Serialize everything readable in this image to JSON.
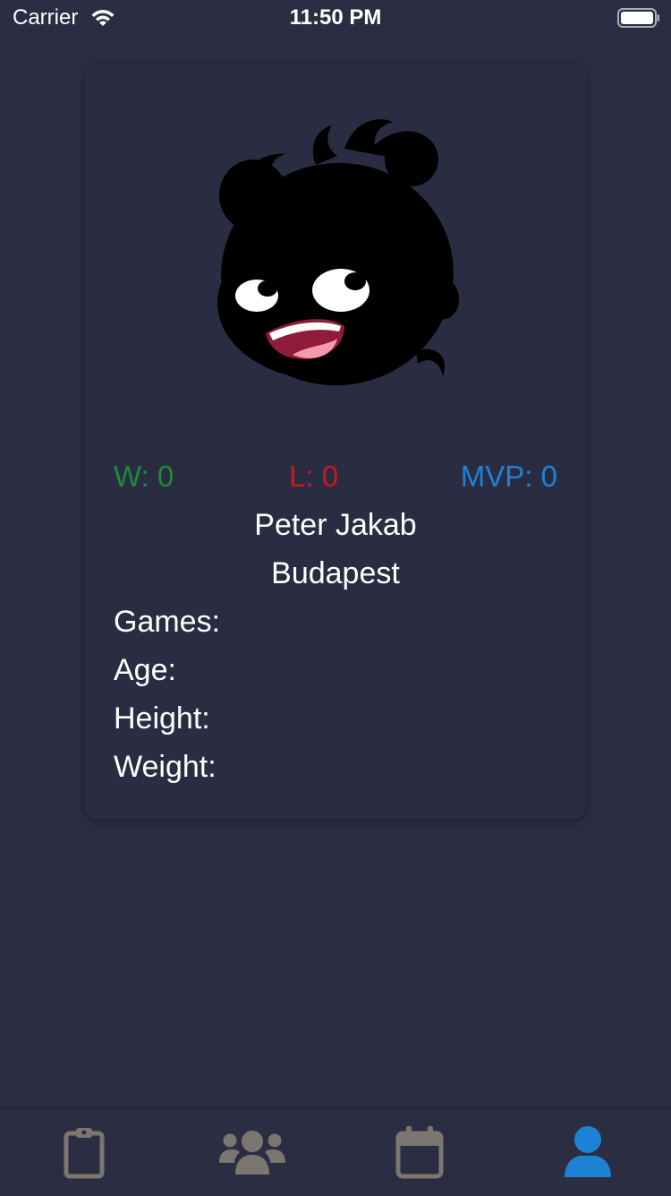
{
  "status_bar": {
    "carrier": "Carrier",
    "time": "11:50 PM",
    "wifi_icon": "wifi-icon",
    "battery_icon": "battery-full-icon"
  },
  "profile": {
    "avatar_icon": "cartoon-face-avatar",
    "stats": {
      "wins": "W: 0",
      "losses": "L: 0",
      "mvp": "MVP: 0"
    },
    "name": "Peter Jakab",
    "city": "Budapest",
    "fields": {
      "games": "Games:",
      "age": "Age:",
      "height": "Height:",
      "weight": "Weight:"
    }
  },
  "tab_bar": {
    "tabs": [
      {
        "icon": "clipboard-icon",
        "active": false
      },
      {
        "icon": "users-icon",
        "active": false
      },
      {
        "icon": "calendar-icon",
        "active": false
      },
      {
        "icon": "user-icon",
        "active": true
      }
    ]
  },
  "colors": {
    "background": "#2b2d42",
    "wins": "#1e8a3a",
    "losses": "#c8191f",
    "mvp": "#1d82d4",
    "tab_inactive": "#7c7670",
    "tab_active": "#1d82d4"
  }
}
